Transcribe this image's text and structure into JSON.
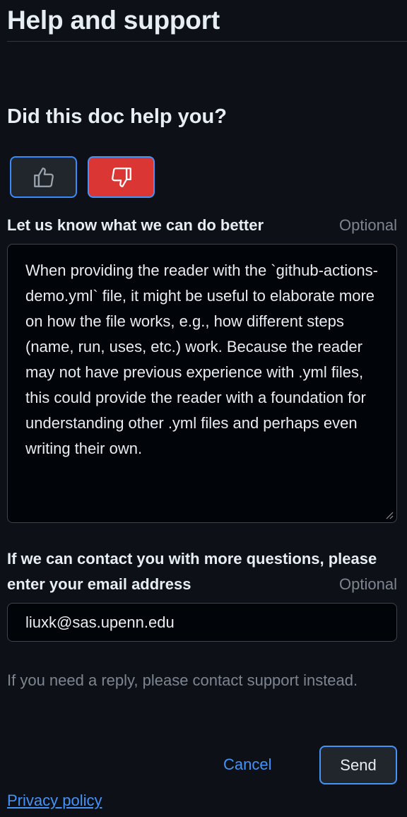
{
  "header": {
    "title": "Help and support"
  },
  "feedback": {
    "question": "Did this doc help you?",
    "thumbs_up": {
      "icon": "thumbs-up-icon",
      "selected": false
    },
    "thumbs_down": {
      "icon": "thumbs-down-icon",
      "selected": true
    },
    "details_label": "Let us know what we can do better",
    "details_optional": "Optional",
    "details_value": "When providing the reader with the `github-actions-demo.yml` file, it might be useful to elaborate more on how the file works, e.g., how different steps (name, run, uses, etc.) work. Because the reader may not have previous experience with .yml files, this could provide the reader with a foundation for understanding other .yml files and perhaps even writing their own.",
    "email_label": "If we can contact you with more questions, please enter your email address",
    "email_optional": "Optional",
    "email_value": "liuxk@sas.upenn.edu",
    "helper_text": "If you need a reply, please contact support instead.",
    "cancel_label": "Cancel",
    "send_label": "Send",
    "privacy_link": "Privacy policy"
  },
  "colors": {
    "background": "#0d1117",
    "accent": "#4493f8",
    "thumbs_down_active": "#da3633",
    "muted_text": "#7d8590"
  }
}
